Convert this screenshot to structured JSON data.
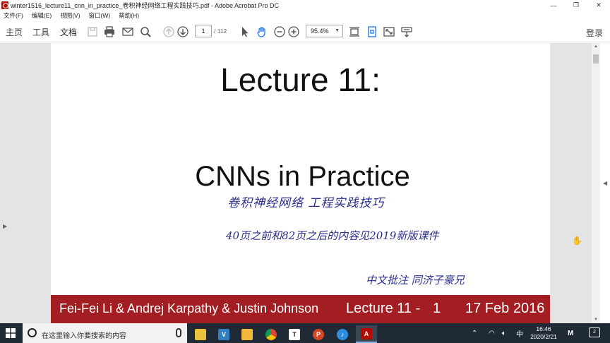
{
  "window": {
    "title": "winter1516_lecture11_cnn_in_practice_卷积神经网络工程实践技巧.pdf - Adobe Acrobat Pro DC",
    "minimize": "—",
    "maximize": "❐",
    "close": "✕"
  },
  "menu": [
    "文件(F)",
    "编辑(E)",
    "视图(V)",
    "窗口(W)",
    "帮助(H)"
  ],
  "nav_tabs": [
    "主页",
    "工具",
    "文档"
  ],
  "active_tab": "文档",
  "toolbar": {
    "current_page": "1",
    "total_pages": "/ 112",
    "zoom": "95.4%",
    "login_label": "登录",
    "icons": [
      "save-icon",
      "print-icon",
      "email-icon",
      "search-icon",
      "page-up-icon",
      "page-down-icon",
      "select-cursor-icon",
      "hand-tool-icon",
      "zoom-out-icon",
      "zoom-in-icon",
      "fit-width-icon",
      "rotate-icon",
      "fullscreen-icon",
      "read-mode-icon"
    ]
  },
  "page": {
    "title": "Lecture 11:",
    "subtitle": "CNNs in Practice",
    "handwriting": [
      "卷积神经网络   工程实践技巧",
      "40页之前和82页之后的内容见2019新版课件",
      "中文批注   同济子豪兄"
    ],
    "footer": {
      "authors": "Fei-Fei Li & Andrej Karpathy & Justin Johnson",
      "lecture": "Lecture 11 -",
      "page_num": "1",
      "date": "17 Feb 2016"
    }
  },
  "taskbar": {
    "search_placeholder": "在这里输入你要搜索的内容",
    "apps": [
      "file-explorer",
      "visual-studio-code",
      "folder",
      "chrome",
      "typora",
      "powerpoint",
      "app-blue",
      "adobe-acrobat"
    ],
    "ime": "中",
    "time": "16:46",
    "date": "2020/2/21",
    "notification_count": "2"
  },
  "colors": {
    "footer_bg": "#a31e22",
    "taskbar_bg": "#1f2a36",
    "handwriting": "#2a2d8a"
  }
}
